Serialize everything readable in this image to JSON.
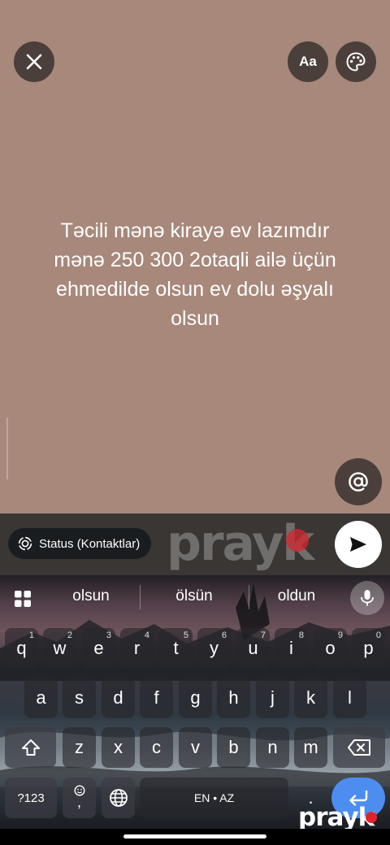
{
  "toolbar": {
    "font_label": "Aa"
  },
  "status": {
    "text": "Təcili mənə kirayə ev lazımdır mənə 250 300 2otaqli ailə üçün ehmedilde olsun ev dolu əşyalı olsun"
  },
  "compose": {
    "audience_label": "Status (Kontaktlar)",
    "watermark": "prayk"
  },
  "keyboard": {
    "suggestions": [
      "olsun",
      "ölsün",
      "oldun"
    ],
    "row1": [
      {
        "key": "q",
        "hint": "1"
      },
      {
        "key": "w",
        "hint": "2"
      },
      {
        "key": "e",
        "hint": "3"
      },
      {
        "key": "r",
        "hint": "4"
      },
      {
        "key": "t",
        "hint": "5"
      },
      {
        "key": "y",
        "hint": "6"
      },
      {
        "key": "u",
        "hint": "7"
      },
      {
        "key": "i",
        "hint": "8"
      },
      {
        "key": "o",
        "hint": "9"
      },
      {
        "key": "p",
        "hint": "0"
      }
    ],
    "row2": [
      "a",
      "s",
      "d",
      "f",
      "g",
      "h",
      "j",
      "k",
      "l"
    ],
    "row3": [
      "z",
      "x",
      "c",
      "v",
      "b",
      "n",
      "m"
    ],
    "symbols_label": "?123",
    "comma_label": ",",
    "space_label": "EN • AZ",
    "period_label": ".",
    "watermark": "prayk"
  },
  "colors": {
    "status_background": "#a7887b",
    "button_background": "#4a3f3a",
    "enter_key": "#4d8df0",
    "watermark_dot": "#e0232b"
  }
}
